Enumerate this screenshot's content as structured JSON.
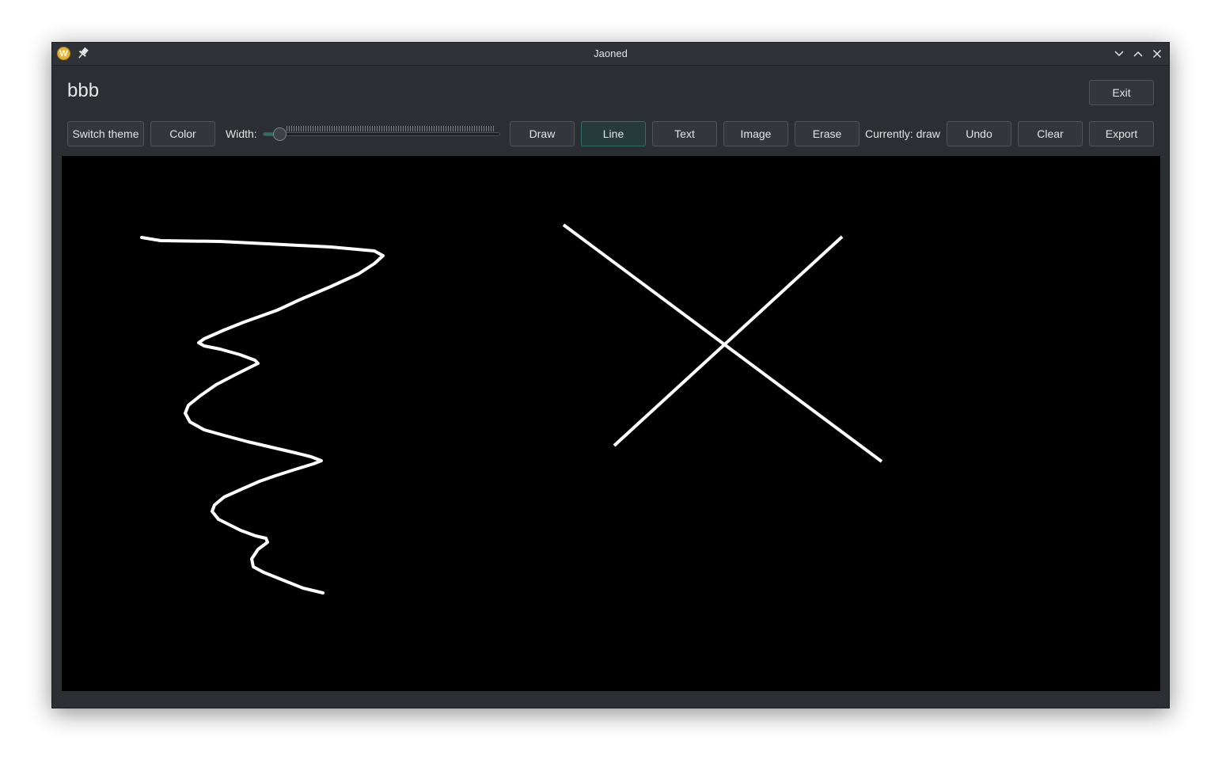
{
  "window": {
    "title": "Jaoned",
    "app_icon": "W"
  },
  "header": {
    "title": "bbb",
    "exit_label": "Exit"
  },
  "toolbar": {
    "switch_theme_label": "Switch theme",
    "color_label": "Color",
    "width_label": "Width:",
    "width_value_fraction": 0.07,
    "draw_label": "Draw",
    "line_label": "Line",
    "text_label": "Text",
    "image_label": "Image",
    "erase_label": "Erase",
    "status_label": "Currently: draw",
    "undo_label": "Undo",
    "clear_label": "Clear",
    "export_label": "Export",
    "active_tool": "Line"
  },
  "canvas": {
    "background": "#000000",
    "stroke_color": "#ffffff"
  },
  "colors": {
    "window_bg": "#2b2e33",
    "accent": "#2f6e67"
  },
  "icons": {
    "app": "app-logo-icon",
    "pin": "pin-icon",
    "minimize": "chevron-down-icon",
    "maximize": "chevron-up-icon",
    "close": "close-icon"
  }
}
